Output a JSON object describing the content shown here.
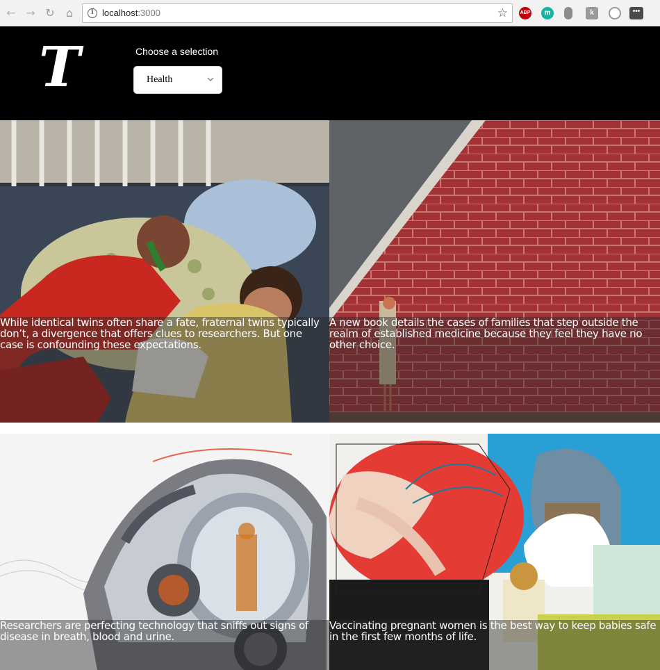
{
  "browser": {
    "url_host": "localhost",
    "url_port": ":3000",
    "extensions": {
      "abp": "ABP",
      "m": "m",
      "k": "k"
    }
  },
  "header": {
    "logo_letter": "T",
    "select_label": "Choose a selection",
    "selected_section": "Health"
  },
  "articles": [
    {
      "abstract": "While identical twins often share a fate, fraternal twins typically don’t, a divergence that offers clues to researchers. But one case is confounding these expectations."
    },
    {
      "abstract": "A new book details the cases of families that step outside the realm of established medicine because they feel they have no other choice."
    },
    {
      "abstract": "Researchers are perfecting technology that sniffs out signs of disease in breath, blood and urine."
    },
    {
      "abstract": "Vaccinating pregnant women is the best way to keep babies safe in the first few months of life."
    }
  ],
  "colors": {
    "header_bg": "#000000",
    "brick": "#9e2b2b",
    "chrome_bg": "#f2f2f2"
  }
}
